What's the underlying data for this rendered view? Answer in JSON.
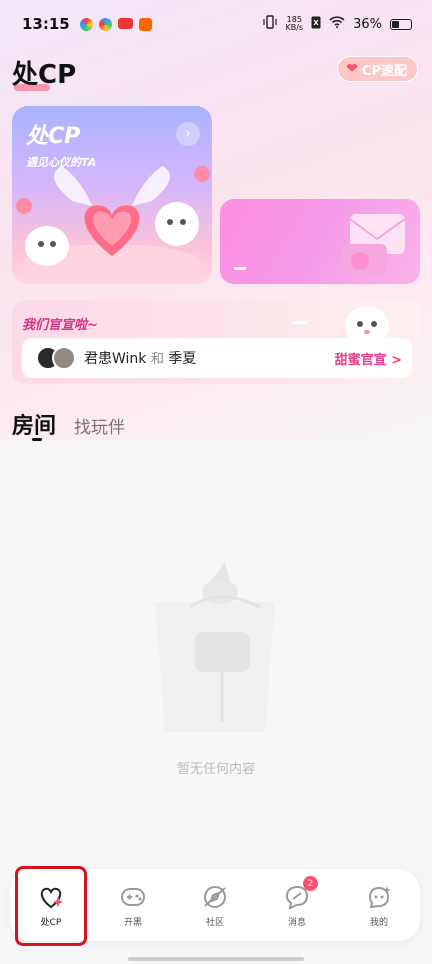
{
  "status_bar": {
    "time": "13:15",
    "net_speed_value": "185",
    "net_speed_unit": "KB/s",
    "battery_percent": "36%",
    "battery_level": 0.36
  },
  "header": {
    "title": "处CP",
    "match_button_label": "CP速配"
  },
  "feature_card": {
    "brand": "处CP",
    "slogan": "遇见心仪的TA"
  },
  "announcement": {
    "title": "我们官宣啦~",
    "name_a": "君患Wink",
    "joiner": "和",
    "name_b": "季夏",
    "link_label": "甜蜜官宣 >"
  },
  "tabs": [
    {
      "label": "房间",
      "active": true
    },
    {
      "label": "找玩伴",
      "active": false
    }
  ],
  "empty_state": {
    "message": "暂无任何内容"
  },
  "bottom_nav": [
    {
      "label": "处CP",
      "icon": "heart-sparkle-icon",
      "active": true
    },
    {
      "label": "开黑",
      "icon": "gamepad-icon",
      "active": false
    },
    {
      "label": "社区",
      "icon": "compass-icon",
      "active": false
    },
    {
      "label": "消息",
      "icon": "chat-bubble-icon",
      "active": false,
      "badge": "2"
    },
    {
      "label": "我的",
      "icon": "robot-face-icon",
      "active": false
    }
  ],
  "colors": {
    "accent_pink": "#ff4d6d",
    "highlight_red": "#d7111d",
    "link_pink": "#e83e8c"
  }
}
